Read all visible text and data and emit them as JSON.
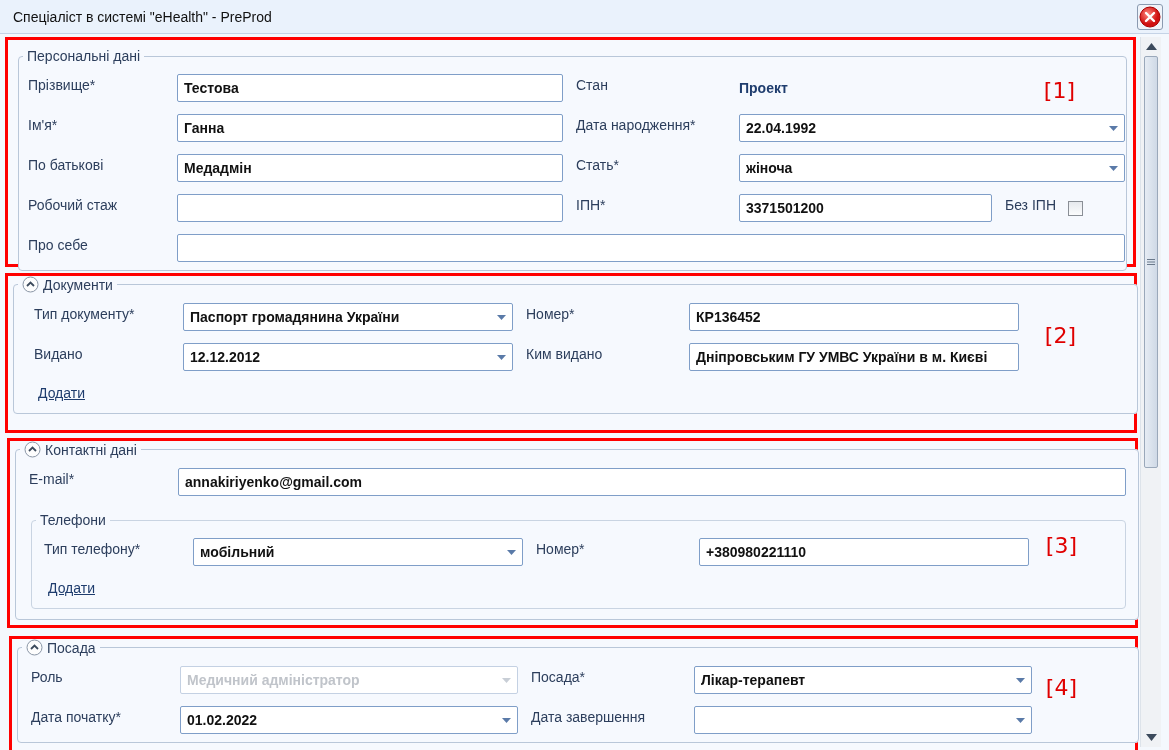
{
  "window": {
    "title": "Спеціаліст в системі \"eHealth\" - PreProd"
  },
  "sections": [
    {
      "legend": "Персональні дані",
      "marker": "[1]",
      "rows": [
        [
          {
            "label": "Прізвище*",
            "kind": "text",
            "value": "Тестова"
          },
          {
            "label": "Стан",
            "kind": "static",
            "value": "Проект"
          }
        ],
        [
          {
            "label": "Ім'я*",
            "kind": "text",
            "value": "Ганна"
          },
          {
            "label": "Дата народження*",
            "kind": "select",
            "value": "22.04.1992"
          }
        ],
        [
          {
            "label": "По батькові",
            "kind": "text",
            "value": "Медадмін"
          },
          {
            "label": "Стать*",
            "kind": "select",
            "value": "жіноча"
          }
        ],
        [
          {
            "label": "Робочий стаж",
            "kind": "text"
          },
          {
            "label": "ІПН*",
            "kind": "text",
            "value": "3371501200",
            "option": {
              "label": "Без ІПН",
              "checked": false
            }
          }
        ],
        [
          {
            "label": "Про себе",
            "kind": "text"
          }
        ]
      ]
    },
    {
      "legend": "Документи",
      "expanded": true,
      "marker": "[2]",
      "rows": [
        [
          {
            "label": "Тип документу*",
            "kind": "select",
            "value": "Паспорт громадянина України"
          },
          {
            "label": "Номер*",
            "kind": "text",
            "value": "КР136452"
          }
        ],
        [
          {
            "label": "Видано",
            "kind": "select",
            "value": "12.12.2012"
          },
          {
            "label": "Ким видано",
            "kind": "text",
            "value": "Дніпровським ГУ УМВС України в м. Києві"
          }
        ]
      ],
      "link": "Додати"
    },
    {
      "legend": "Контактні дані",
      "expanded": true,
      "marker": "[3]",
      "rows": [
        [
          {
            "label": "E-mail*",
            "kind": "text",
            "value": "annakiriyenko@gmail.com"
          }
        ]
      ],
      "group": {
        "legend": "Телефони",
        "rows": [
          [
            {
              "label": "Тип телефону*",
              "kind": "select",
              "value": "мобільний"
            },
            {
              "label": "Номер*",
              "kind": "text",
              "value": "+380980221110"
            }
          ]
        ],
        "link": "Додати"
      }
    },
    {
      "legend": "Посада",
      "expanded": true,
      "marker": "[4]",
      "rows": [
        [
          {
            "label": "Роль",
            "kind": "select",
            "value": "Медичний адміністратор",
            "disabled": true
          },
          {
            "label": "Посада*",
            "kind": "select",
            "value": "Лікар-терапевт"
          }
        ],
        [
          {
            "label": "Дата початку*",
            "kind": "select",
            "value": "01.02.2022"
          },
          {
            "label": "Дата завершення",
            "kind": "select"
          }
        ]
      ]
    }
  ]
}
